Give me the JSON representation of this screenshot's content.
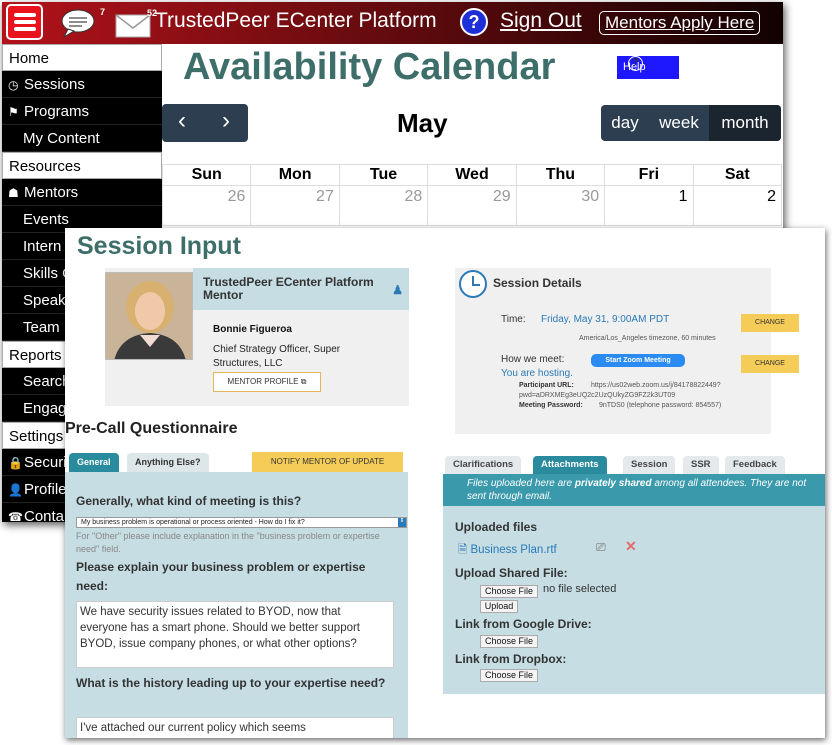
{
  "header": {
    "chat_badge": "7",
    "mail_badge": "52",
    "brand": "TrustedPeer ECenter Platform",
    "help_symbol": "?",
    "sign_out": "Sign Out",
    "mentors_apply": "Mentors Apply Here",
    "brand_color": "#b3121a"
  },
  "sidebar": {
    "items": [
      {
        "label": "Home",
        "type": "section"
      },
      {
        "label": "Sessions",
        "type": "item",
        "icon": "clock-icon"
      },
      {
        "label": "Programs",
        "type": "item",
        "icon": "flags-icon"
      },
      {
        "label": "My Content",
        "type": "sub"
      },
      {
        "label": "Resources",
        "type": "section"
      },
      {
        "label": "Mentors",
        "type": "item",
        "icon": "users-icon"
      },
      {
        "label": "Events",
        "type": "sub"
      },
      {
        "label": "Intern",
        "type": "sub"
      },
      {
        "label": "Skills C",
        "type": "sub"
      },
      {
        "label": "Speak",
        "type": "sub"
      },
      {
        "label": "Team",
        "type": "sub"
      },
      {
        "label": "Reports",
        "type": "section"
      },
      {
        "label": "Search",
        "type": "sub"
      },
      {
        "label": "Engag",
        "type": "sub"
      },
      {
        "label": "Settings",
        "type": "section"
      },
      {
        "label": "Securi",
        "type": "item",
        "icon": "lock-icon"
      },
      {
        "label": "Profile",
        "type": "item",
        "icon": "user-icon"
      },
      {
        "label": "Conta",
        "type": "item",
        "icon": "contact-icon"
      }
    ]
  },
  "calendar": {
    "title": "Availability Calendar",
    "help_label": "Help",
    "month": "May",
    "prev": "‹",
    "next": "›",
    "views": [
      "day",
      "week",
      "month"
    ],
    "active_view": "month",
    "days": [
      "Sun",
      "Mon",
      "Tue",
      "Wed",
      "Thu",
      "Fri",
      "Sat"
    ],
    "dates": [
      "26",
      "27",
      "28",
      "29",
      "30",
      "1",
      "2"
    ],
    "accent_color": "#2c3e50"
  },
  "session": {
    "title": "Session Input",
    "mentor_header": "TrustedPeer ECenter Platform Mentor",
    "mentor_name": "Bonnie Figueroa",
    "mentor_title": "Chief Strategy Officer, Super Structures, LLC",
    "mentor_profile_button": "MENTOR PROFILE",
    "details_title": "Session Details",
    "time_label": "Time:",
    "time_value": "Friday, May 31, 9:00AM PDT",
    "timezone_note": "America/Los_Angeles timezone, 60 minutes",
    "meet_label": "How we meet:",
    "zoom_button": "Start Zoom Meeting",
    "hosting_text": "You are hosting.",
    "participant_label": "Participant URL:",
    "participant_url": "https://us02web.zoom.us/j/84178822449?",
    "participant_url_2": "pwd=aDRXMEg3eUQ2c2UzQUkyZG9FZ2k3UT09",
    "password_label": "Meeting Password:",
    "password_value": "9nTDS0 (telephone password: 854557)",
    "change_label": "CHANGE"
  },
  "questionnaire": {
    "title": "Pre-Call Questionnaire",
    "tabs": [
      "General",
      "Anything Else?"
    ],
    "notify_button": "NOTIFY MENTOR OF UPDATE",
    "q1": "Generally, what kind of meeting is this?",
    "q1_selected": "My business problem is operational or process oriented - How do I fix it?",
    "q1_hint": "For \"Other\" please include explanation in the \"business problem or expertise need\" field.",
    "q2": "Please explain your business problem or expertise need:",
    "a2": "We have security issues related to BYOD, now that everyone has a smart phone. Should we better support BYOD, issue company phones, or what other options?",
    "q3": "What is the history leading up to your expertise need?",
    "a3": "I've attached our current policy which seems"
  },
  "attachments": {
    "tabs": [
      "Clarifications",
      "Attachments",
      "Session",
      "SSR",
      "Feedback"
    ],
    "active_tab": "Attachments",
    "notice_pre": "Files uploaded here are ",
    "notice_bold": "privately shared",
    "notice_post": " among all attendees. They are not sent through email.",
    "uploaded_heading": "Uploaded files",
    "file_name": "Business Plan.rtf",
    "upload_shared": "Upload Shared File:",
    "choose_file": "Choose File",
    "no_file": "no file selected",
    "upload_button": "Upload",
    "google_drive": "Link from Google Drive:",
    "dropbox": "Link from Dropbox:",
    "panel_color": "#c5dde3"
  }
}
